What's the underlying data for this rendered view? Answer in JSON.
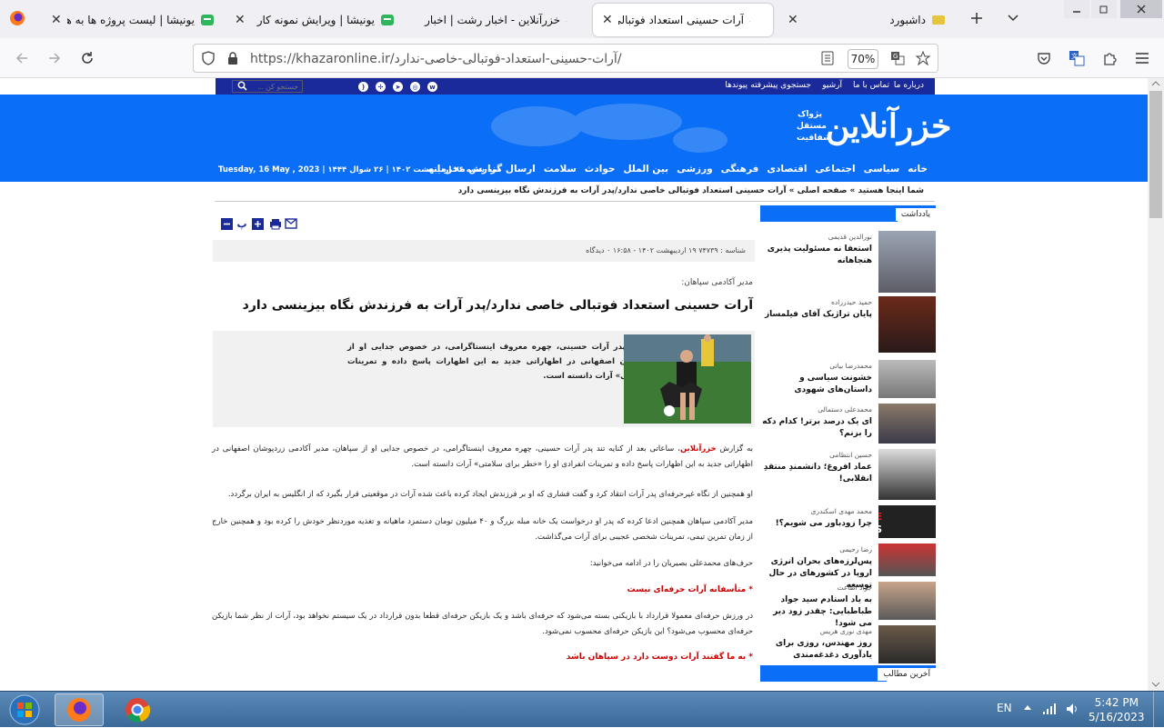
{
  "tabs": [
    {
      "title": "یونیشا | لیست پروژه ها به همراه",
      "icon": "unisha-icon"
    },
    {
      "title": "یونیشا | ویرایش نمونه کار",
      "icon": "unisha-icon"
    },
    {
      "title": "خزرآنلاین - اخبار رشت | اخبار",
      "icon": "khazar-icon"
    },
    {
      "title": "آرات حسینی استعداد فوتبالی خ",
      "icon": "khazar-icon",
      "active": true
    },
    {
      "title": "داشبورد",
      "icon": "dashboard-icon"
    }
  ],
  "browser": {
    "url": "https://khazaronline.ir/آرات-حسینی-استعداد-فوتبالی-خاصی-ندارد/",
    "zoom": "70%"
  },
  "site": {
    "top_links": [
      "درباره ما",
      "تماس با ما",
      "آرشیو",
      "جستجوی پیشرفته",
      "پیوندها"
    ],
    "search_placeholder": "جستجو کن ...",
    "logo": "خزرآنلاین",
    "slogan": [
      "پژواک",
      "مستقل",
      "شفافیت"
    ],
    "nav": [
      "خانه",
      "سیاسی",
      "اجتماعی",
      "اقتصادی",
      "فرهنگی",
      "ورزشی",
      "بین الملل",
      "حوادث",
      "سلامت",
      "ارسال گزارش محرمانه"
    ],
    "date": "سه شنبه ۲۶ اردیبهشت ۱۴۰۲ | ۲۶ شوال ۱۴۴۴ | Tuesday, 16 May , 2023",
    "breadcrumb": "شما اینجا هستید »   صفحه اصلی »   آرات حسینی استعداد فوتبالی خاصی ندارد/پدر آرات به فرزندش نگاه بیزینسی دارد"
  },
  "sidebar": {
    "section1": "یادداشت",
    "items": [
      {
        "author": "نورالدین قدیمی",
        "title": "استعفا نه مسئولیت پذیری هنجاهانه"
      },
      {
        "author": "حمید حیدرزاده",
        "title": "پایان تراژیک آقای فیلمساز"
      },
      {
        "author": "محمدرضا بیاتی",
        "title": "خشونت سیاسی و داستان‌های شهودی"
      },
      {
        "author": "محمدعلی دستمالی",
        "title": "ای یک درصد برتر! کدام دکه را بزنم؟"
      },
      {
        "author": "حسین انتظامی",
        "title": "عماد افروغ؛ دانشمندِ منتقدِ انقلابی!"
      },
      {
        "author": "محمد مهدی اسکندری",
        "title": "چرا زودباور می شویم؟!"
      },
      {
        "author": "رضا رحیمی",
        "title": "پس‌لرزه‌های بحران انرژی اروپا در کشورهای در حال توسعه"
      },
      {
        "author": "جواد اطاعت",
        "title": "به یاد استادم سید جواد طباطبایی: چقدر زود دیر می شود!"
      },
      {
        "author": "مهدی نوری هریس",
        "title": "روز مهندس، روزی برای یادآوری دغدغه‌مندی"
      }
    ],
    "section2": "آخرین مطالب"
  },
  "article": {
    "meta": "شناسه : ۷۴۷۳۹     ۱۹ اردیبهشت ۱۴۰۲ - ۱۶:۵۸     ۰ دیدگاه",
    "kicker": "مدیر آکادمی سپاهان:",
    "headline": "آرات حسینی استعداد فوتبالی خاصی ندارد/پدر آرات به فرزندش نگاه بیزینسی دارد",
    "lead": "خزر: ساعاتی بعد از کنایه تند پدر آرات حسینی، چهره معروف اینستاگرامی، در خصوص جدایی او از سپاهان، مدیر آکادمی زردپوشان اصفهانی در اظهاراتی جدید به این اظهارات پاسخ داده و تمرینات انفرادی او را «خطر برای سلامتی» آرات دانسته است.",
    "p1_prefix": "به گزارش",
    "p1_brand": "خزرآنلاین",
    "p1": "، ساعاتی بعد از کنایه تند پدر آرات حسینی، چهره معروف اینستاگرامی، در خصوص جدایی او از سپاهان، مدیر آکادمی زردپوشان اصفهانی در اظهاراتی جدید به این اظهارات پاسخ داده و تمرینات انفرادی او را «خطر برای سلامتی» آرات دانسته است.",
    "p2": "او همچنین از نگاه غیرحرفه‌ای پدر آرات انتقاد کرد و گفت فشاری که او بر فرزندش ایجاد کرده باعث شده آرات در موقعیتی قرار بگیرد که از انگلیس به ایران برگردد.",
    "p3": "مدیر آکادمی سپاهان همچنین ادعا کرده که پدر او درخواست یک خانه مبله بزرگ و ۴۰ میلیون تومان دستمزد ماهیانه و تغذیه موردنظر خودش را کرده بود و همچنین خارج از زمان تمرین تیمی، تمرینات شخصی عجیبی برای آرات می‌گذاشت.",
    "p4": "حرف‌های محمدعلی بصیریان را در ادامه می‌خوانید:",
    "h1": "* متأسفانه آرات حرفه‌ای نیست",
    "p5": "در ورزش حرفه‌ای معمولا قرارداد با بازیکنی بسته می‌شود که حرفه‌ای باشد و یک بازیکن حرفه‌ای قطعا بدون قرارداد در یک سیستم نخواهد بود، آرات از نظر شما بازیکن حرفه‌ای محسوب می‌شود؟ این بازیکن حرفه‌ای محسوب نمی‌شود.",
    "h2": "* به ما گفتند آرات دوست دارد در سپاهان باشد"
  },
  "taskbar": {
    "lang": "EN",
    "time": "5:42 PM",
    "date": "5/16/2023"
  }
}
